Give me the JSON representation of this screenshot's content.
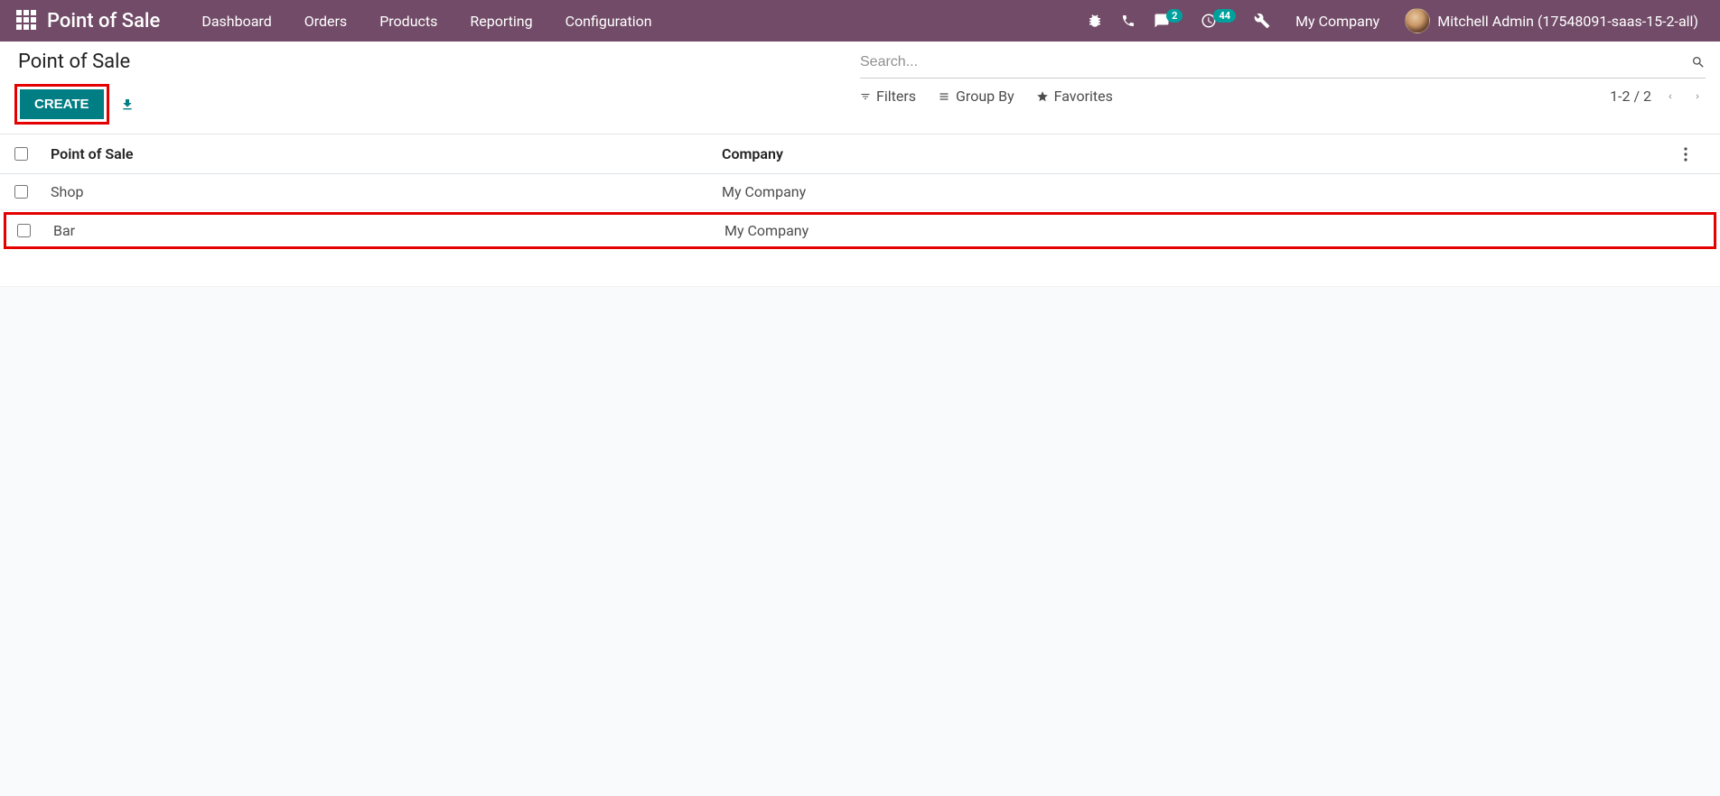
{
  "nav": {
    "brand": "Point of Sale",
    "menu": [
      "Dashboard",
      "Orders",
      "Products",
      "Reporting",
      "Configuration"
    ],
    "messages_badge": "2",
    "activities_badge": "44",
    "company": "My Company",
    "user": "Mitchell Admin (17548091-saas-15-2-all)"
  },
  "breadcrumb": "Point of Sale",
  "buttons": {
    "create": "CREATE"
  },
  "search": {
    "placeholder": "Search...",
    "filters": "Filters",
    "groupby": "Group By",
    "favorites": "Favorites"
  },
  "pager": {
    "range": "1-2 / 2"
  },
  "table": {
    "headers": {
      "name": "Point of Sale",
      "company": "Company"
    },
    "rows": [
      {
        "name": "Shop",
        "company": "My Company"
      },
      {
        "name": "Bar",
        "company": "My Company"
      }
    ]
  }
}
